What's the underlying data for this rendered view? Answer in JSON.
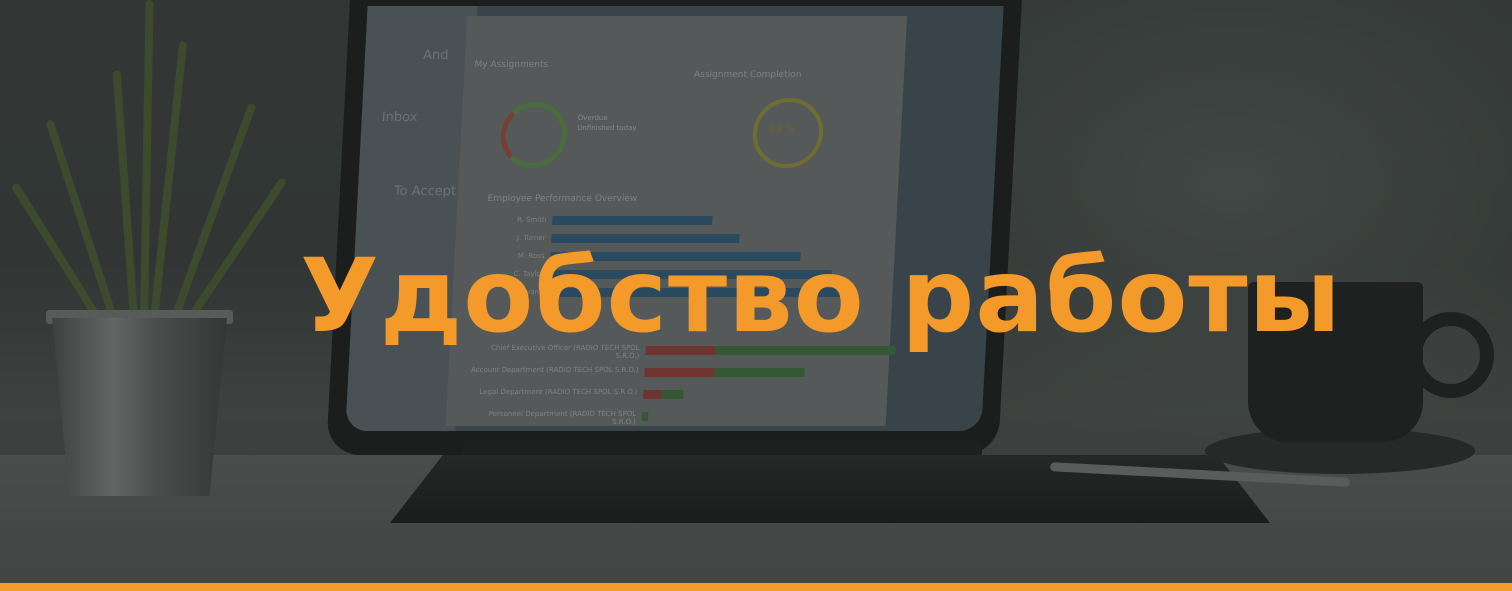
{
  "hero": {
    "headline": "Удобство работы",
    "headline_color": "#f39a2a",
    "accent_color": "#f39a2a"
  },
  "screen": {
    "user_short": "And",
    "inbox_label": "Inbox",
    "to_accept_label": "To Accept",
    "card_my_assignments": "My Assignments",
    "card_assignment_completion": "Assignment Completion",
    "completion_value": "63 %",
    "legend": [
      "Overdue",
      "Unfinished today"
    ],
    "chart_title": "Employee Performance Overview",
    "bar_rows": [
      {
        "name": "R. Smith",
        "value": "45 %"
      },
      {
        "name": "J. Turner",
        "value": "50 %"
      },
      {
        "name": "M. Ross",
        "value": "70 %"
      },
      {
        "name": "C. Taylor",
        "value": "75 %"
      },
      {
        "name": "B. Evans",
        "value": "82 %"
      }
    ],
    "departments": [
      "Chief Executive Officer (RADIO TECH SPOL S.R.O.)",
      "Account Department (RADIO TECH SPOL S.R.O.)",
      "Legal Department (RADIO TECH SPOL S.R.O.)",
      "Personnel Department (RADIO TECH SPOL S.R.O.)"
    ]
  },
  "icons": {
    "plant": "plant-icon",
    "laptop": "laptop-icon",
    "cup": "coffee-cup-icon"
  }
}
